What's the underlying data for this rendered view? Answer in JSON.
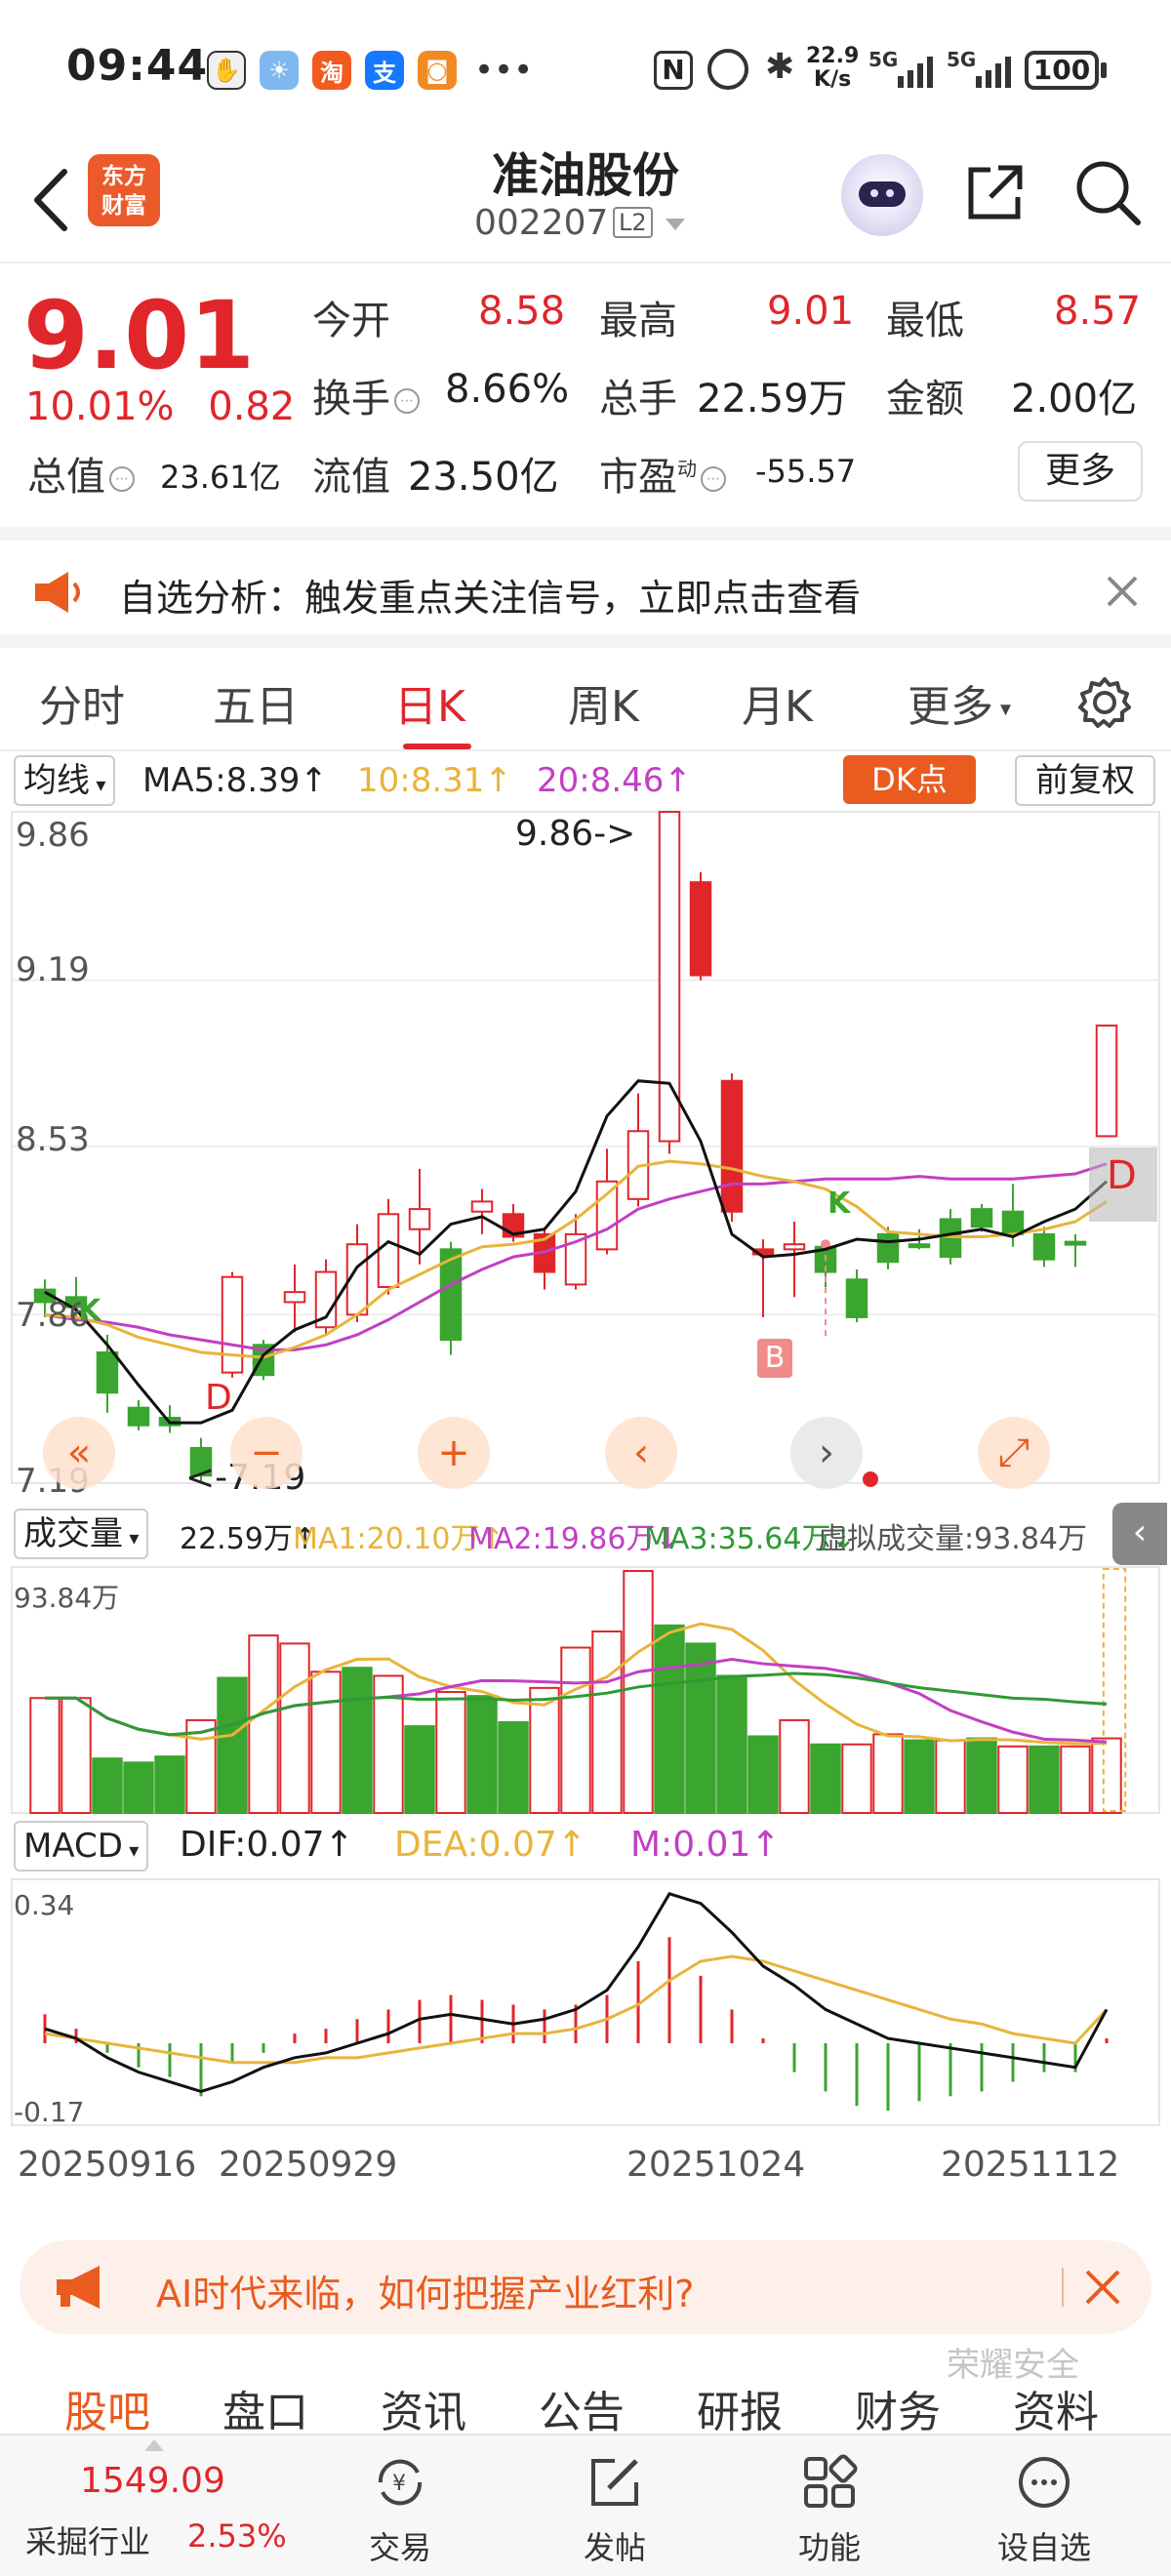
{
  "status_bar": {
    "time": "09:44",
    "net_speed": "22.9",
    "net_unit": "K/s",
    "battery": "100"
  },
  "header": {
    "brand_line1": "东方",
    "brand_line2": "财富",
    "stock_name": "准油股份",
    "stock_code": "002207",
    "level_badge": "L2"
  },
  "quote": {
    "price": "9.01",
    "change_pct": "10.01%",
    "change_abs": "0.82",
    "open_label": "今开",
    "open": "8.58",
    "high_label": "最高",
    "high": "9.01",
    "low_label": "最低",
    "low": "8.57",
    "turnover_label": "换手",
    "turnover": "8.66%",
    "volume_label": "总手",
    "volume": "22.59万",
    "amount_label": "金额",
    "amount": "2.00亿",
    "mktcap_label": "总值",
    "mktcap": "23.61亿",
    "float_label": "流值",
    "float_cap": "23.50亿",
    "pe_label": "市盈",
    "pe_super": "动",
    "pe": "-55.57",
    "more_label": "更多"
  },
  "notice": {
    "text": "自选分析：触发重点关注信号，立即点击查看"
  },
  "tabs": [
    "分时",
    "五日",
    "日K",
    "周K",
    "月K",
    "更多"
  ],
  "active_tab": "日K",
  "indicator_bar": {
    "selector": "均线",
    "ma5": "MA5:8.39↑",
    "ma10": "10:8.31↑",
    "ma20": "20:8.46↑",
    "dk_label": "DK点",
    "adjust_label": "前复权"
  },
  "price_chart": {
    "y_labels": [
      "9.86",
      "9.19",
      "8.53",
      "7.86",
      "7.19"
    ],
    "high_annotation": "9.86->",
    "low_annotation": "<-7.19",
    "markers": {
      "buy": "B",
      "d": "D",
      "k": "K"
    }
  },
  "volume_bar": {
    "selector": "成交量",
    "vol": "22.59万↑",
    "ma1": "MA1:20.10万↑",
    "ma2": "MA2:19.86万↓",
    "ma3": "MA3:35.64万↓",
    "virtual": "虚拟成交量:93.84万",
    "max_label": "93.84万"
  },
  "macd_bar": {
    "selector": "MACD",
    "dif": "DIF:0.07↑",
    "dea": "DEA:0.07↑",
    "m": "M:0.01↑",
    "y_top": "0.34",
    "y_bottom": "-0.17"
  },
  "dates": [
    "20250916",
    "20250929",
    "20251024",
    "20251112"
  ],
  "banner": {
    "text": "AI时代来临，如何把握产业红利?"
  },
  "bottom_tabs": [
    "股吧",
    "盘口",
    "资讯",
    "公告",
    "研报",
    "财务",
    "资料"
  ],
  "watermark": "荣耀安全",
  "bottom_nav": {
    "index_value": "1549.09",
    "index_name": "采掘行业",
    "index_pct": "2.53%",
    "items": [
      "交易",
      "发帖",
      "功能",
      "设自选"
    ]
  },
  "colors": {
    "up": "#e0262b",
    "down": "#3aa52f",
    "ma5": "#111111",
    "ma10": "#e8b43a",
    "ma20": "#c23fc4",
    "accent": "#e95b1f"
  },
  "chart_data": {
    "type": "candlestick",
    "candles": [
      {
        "o": 7.96,
        "c": 7.91,
        "h": 8.0,
        "l": 7.85,
        "up": false
      },
      {
        "o": 7.93,
        "c": 7.89,
        "h": 8.01,
        "l": 7.82,
        "up": false
      },
      {
        "o": 7.71,
        "c": 7.55,
        "h": 7.78,
        "l": 7.47,
        "up": false
      },
      {
        "o": 7.49,
        "c": 7.42,
        "h": 7.52,
        "l": 7.4,
        "up": false
      },
      {
        "o": 7.45,
        "c": 7.42,
        "h": 7.5,
        "l": 7.39,
        "up": false
      },
      {
        "o": 7.33,
        "c": 7.22,
        "h": 7.37,
        "l": 7.19,
        "up": false
      },
      {
        "o": 7.63,
        "c": 8.01,
        "h": 8.03,
        "l": 7.61,
        "up": true
      },
      {
        "o": 7.74,
        "c": 7.62,
        "h": 7.76,
        "l": 7.6,
        "up": false
      },
      {
        "o": 7.91,
        "c": 7.95,
        "h": 8.06,
        "l": 7.79,
        "up": true
      },
      {
        "o": 7.81,
        "c": 8.03,
        "h": 8.08,
        "l": 7.78,
        "up": true
      },
      {
        "o": 7.86,
        "c": 8.14,
        "h": 8.22,
        "l": 7.83,
        "up": true
      },
      {
        "o": 7.97,
        "c": 8.26,
        "h": 8.32,
        "l": 7.94,
        "up": true
      },
      {
        "o": 8.2,
        "c": 8.28,
        "h": 8.44,
        "l": 8.06,
        "up": true
      },
      {
        "o": 8.12,
        "c": 7.76,
        "h": 8.15,
        "l": 7.7,
        "up": false
      },
      {
        "o": 8.27,
        "c": 8.31,
        "h": 8.36,
        "l": 8.18,
        "up": true
      },
      {
        "o": 8.26,
        "c": 8.17,
        "h": 8.3,
        "l": 8.15,
        "up": true
      },
      {
        "o": 8.18,
        "c": 8.03,
        "h": 8.2,
        "l": 7.96,
        "up": true
      },
      {
        "o": 7.98,
        "c": 8.18,
        "h": 8.26,
        "l": 7.96,
        "up": true
      },
      {
        "o": 8.12,
        "c": 8.39,
        "h": 8.52,
        "l": 8.1,
        "up": true
      },
      {
        "o": 8.32,
        "c": 8.59,
        "h": 8.74,
        "l": 8.29,
        "up": true
      },
      {
        "o": 8.55,
        "c": 9.86,
        "h": 9.86,
        "l": 8.5,
        "up": true
      },
      {
        "o": 9.58,
        "c": 9.21,
        "h": 9.62,
        "l": 9.19,
        "up": true
      },
      {
        "o": 8.79,
        "c": 8.27,
        "h": 8.82,
        "l": 8.23,
        "up": true
      },
      {
        "o": 8.12,
        "c": 8.1,
        "h": 8.16,
        "l": 7.85,
        "up": true
      },
      {
        "o": 8.12,
        "c": 8.14,
        "h": 8.23,
        "l": 7.93,
        "up": true
      },
      {
        "o": 8.13,
        "c": 8.03,
        "h": 8.15,
        "l": 7.97,
        "up": false
      },
      {
        "o": 8.0,
        "c": 7.85,
        "h": 8.04,
        "l": 7.83,
        "up": false
      },
      {
        "o": 8.07,
        "c": 8.18,
        "h": 8.21,
        "l": 8.04,
        "up": false
      },
      {
        "o": 8.13,
        "c": 8.14,
        "h": 8.2,
        "l": 8.12,
        "up": false
      },
      {
        "o": 8.09,
        "c": 8.24,
        "h": 8.28,
        "l": 8.06,
        "up": false
      },
      {
        "o": 8.21,
        "c": 8.28,
        "h": 8.3,
        "l": 8.19,
        "up": false
      },
      {
        "o": 8.18,
        "c": 8.27,
        "h": 8.38,
        "l": 8.13,
        "up": false
      },
      {
        "o": 8.18,
        "c": 8.08,
        "h": 8.21,
        "l": 8.05,
        "up": false
      },
      {
        "o": 8.15,
        "c": 8.14,
        "h": 8.18,
        "l": 8.05,
        "up": false
      },
      {
        "o": 8.57,
        "c": 9.01,
        "h": 9.01,
        "l": 8.57,
        "up": true
      }
    ],
    "ma5": [
      7.95,
      7.88,
      7.74,
      7.58,
      7.43,
      7.43,
      7.48,
      7.7,
      7.8,
      7.85,
      8.05,
      8.15,
      8.1,
      8.22,
      8.25,
      8.18,
      8.2,
      8.35,
      8.65,
      8.79,
      8.78,
      8.55,
      8.18,
      8.09,
      8.1,
      8.12,
      8.16,
      8.15,
      8.16,
      8.18,
      8.2,
      8.17,
      8.23,
      8.28,
      8.39
    ],
    "ma10": [
      7.86,
      7.85,
      7.82,
      7.77,
      7.74,
      7.71,
      7.7,
      7.69,
      7.73,
      7.78,
      7.86,
      7.96,
      8.02,
      8.08,
      8.13,
      8.14,
      8.16,
      8.24,
      8.34,
      8.45,
      8.47,
      8.46,
      8.44,
      8.41,
      8.39,
      8.36,
      8.29,
      8.19,
      8.18,
      8.17,
      8.17,
      8.18,
      8.2,
      8.23,
      8.31
    ],
    "ma20": [
      7.86,
      7.84,
      7.83,
      7.81,
      7.78,
      7.76,
      7.74,
      7.72,
      7.72,
      7.74,
      7.78,
      7.84,
      7.91,
      7.98,
      8.04,
      8.09,
      8.11,
      8.15,
      8.2,
      8.28,
      8.32,
      8.35,
      8.38,
      8.38,
      8.39,
      8.4,
      8.4,
      8.4,
      8.41,
      8.4,
      8.4,
      8.4,
      8.41,
      8.42,
      8.46
    ],
    "volume": {
      "values": [
        57,
        57,
        27,
        25,
        28,
        46,
        67,
        88,
        84,
        70,
        72,
        68,
        43,
        60,
        58,
        45,
        62,
        82,
        90,
        120,
        93,
        84,
        68,
        38,
        46,
        34,
        34,
        39,
        36,
        36,
        37,
        33,
        33,
        33,
        37
      ],
      "up": [
        true,
        true,
        false,
        false,
        false,
        true,
        false,
        true,
        true,
        true,
        false,
        true,
        false,
        true,
        false,
        false,
        true,
        true,
        true,
        true,
        false,
        false,
        false,
        false,
        true,
        false,
        true,
        true,
        false,
        true,
        false,
        true,
        false,
        true,
        true
      ]
    },
    "macd": {
      "bars": [
        0.06,
        0.03,
        -0.02,
        -0.05,
        -0.07,
        -0.11,
        -0.04,
        -0.02,
        0.02,
        0.03,
        0.05,
        0.07,
        0.09,
        0.1,
        0.09,
        0.08,
        0.07,
        0.08,
        0.1,
        0.17,
        0.22,
        0.14,
        0.07,
        0.01,
        -0.06,
        -0.1,
        -0.13,
        -0.14,
        -0.12,
        -0.11,
        -0.1,
        -0.08,
        -0.06,
        -0.06,
        0.01
      ],
      "dif": [
        0.03,
        0.01,
        -0.03,
        -0.06,
        -0.08,
        -0.1,
        -0.08,
        -0.05,
        -0.03,
        -0.02,
        0.0,
        0.02,
        0.05,
        0.06,
        0.05,
        0.04,
        0.05,
        0.07,
        0.11,
        0.2,
        0.31,
        0.29,
        0.23,
        0.16,
        0.12,
        0.07,
        0.04,
        0.01,
        0.0,
        -0.01,
        -0.02,
        -0.03,
        -0.04,
        -0.05,
        0.07
      ],
      "dea": [
        0.02,
        0.01,
        0.0,
        -0.01,
        -0.02,
        -0.03,
        -0.04,
        -0.04,
        -0.04,
        -0.03,
        -0.03,
        -0.02,
        -0.01,
        0.0,
        0.01,
        0.02,
        0.02,
        0.03,
        0.05,
        0.08,
        0.13,
        0.17,
        0.18,
        0.17,
        0.15,
        0.13,
        0.11,
        0.09,
        0.07,
        0.05,
        0.04,
        0.02,
        0.01,
        0.0,
        0.07
      ]
    }
  }
}
